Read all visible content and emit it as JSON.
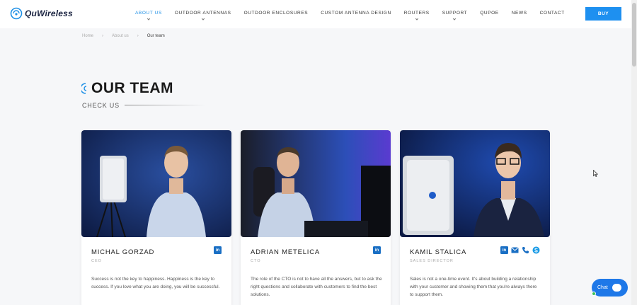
{
  "header": {
    "logo_text": "QuWireless",
    "nav": [
      {
        "label": "ABOUT US",
        "active": true,
        "has_dropdown": true
      },
      {
        "label": "OUTDOOR ANTENNAS",
        "active": false,
        "has_dropdown": true
      },
      {
        "label": "OUTDOOR ENCLOSURES",
        "active": false,
        "has_dropdown": false
      },
      {
        "label": "CUSTOM ANTENNA DESIGN",
        "active": false,
        "has_dropdown": false
      },
      {
        "label": "ROUTERS",
        "active": false,
        "has_dropdown": true
      },
      {
        "label": "SUPPORT",
        "active": false,
        "has_dropdown": true
      },
      {
        "label": "QUPOE",
        "active": false,
        "has_dropdown": false
      },
      {
        "label": "NEWS",
        "active": false,
        "has_dropdown": false
      },
      {
        "label": "CONTACT",
        "active": false,
        "has_dropdown": false
      }
    ],
    "buy_label": "BUY"
  },
  "breadcrumb": {
    "home": "Home",
    "about": "About us",
    "current": "Our team",
    "separator": "›"
  },
  "section": {
    "title": "OUR TEAM",
    "subtitle": "CHECK US"
  },
  "team": [
    {
      "name": "MICHAL GORZAD",
      "role": "CEO",
      "bio": "Success is not the key to happiness. Happiness is the key to success. If you love what you are doing, you will be successful.",
      "socials": [
        "linkedin-icon"
      ]
    },
    {
      "name": "ADRIAN METELICA",
      "role": "CTO",
      "bio": "The role of the CTO is not to have all the answers, but to ask the right questions and collaborate with customers to find the best solutions.",
      "socials": [
        "linkedin-icon"
      ]
    },
    {
      "name": "KAMIL STALICA",
      "role": "SALES DIRECTOR",
      "bio": "Sales is not a one-time event. It's about building a relationship with your customer and showing them that you're always there to support them.",
      "socials": [
        "linkedin-icon",
        "mail-icon",
        "phone-icon",
        "skype-icon"
      ]
    }
  ],
  "chat": {
    "label": "Chat"
  },
  "colors": {
    "accent": "#1e90f0",
    "linkedin": "#1a6fc4",
    "photo_bg": "#1d3a7a"
  }
}
